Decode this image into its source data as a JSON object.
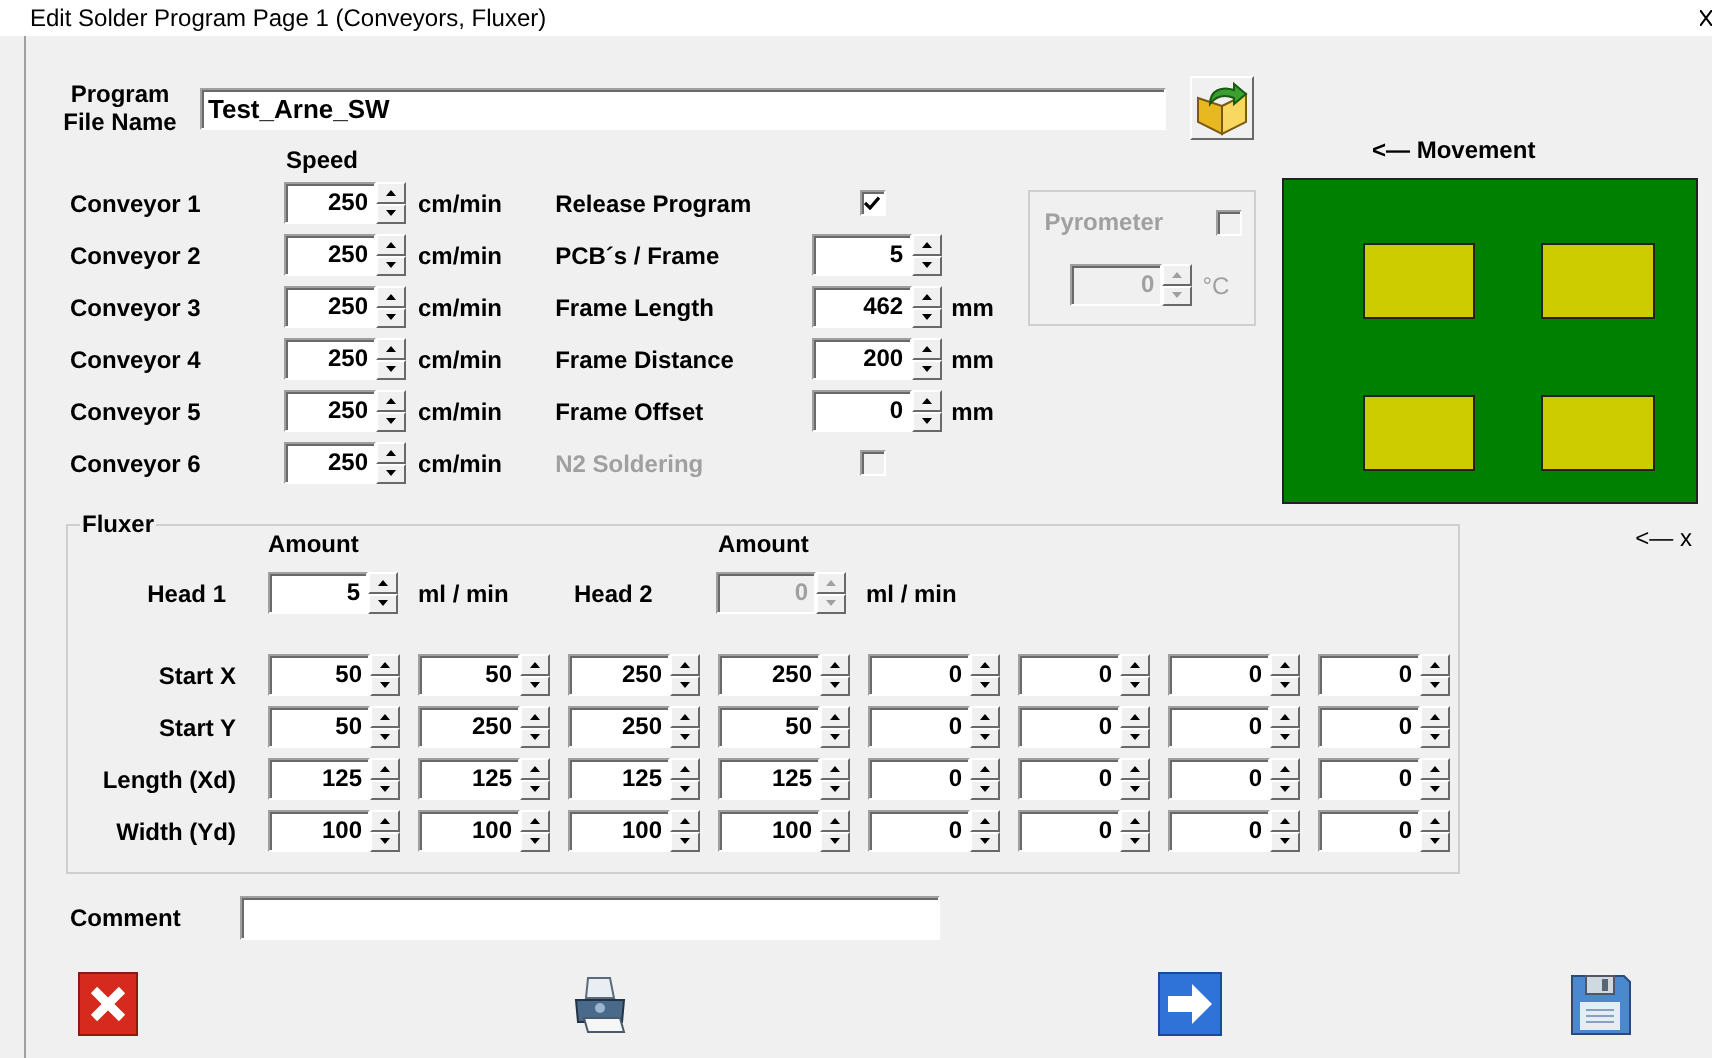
{
  "window": {
    "title": "Edit Solder Program Page 1 (Conveyors, Fluxer)"
  },
  "program_file": {
    "label": "Program File Name",
    "value": "Test_Arne_SW"
  },
  "speed_header": "Speed",
  "conveyors": [
    {
      "label": "Conveyor 1",
      "value": "250",
      "unit": "cm/min"
    },
    {
      "label": "Conveyor 2",
      "value": "250",
      "unit": "cm/min"
    },
    {
      "label": "Conveyor 3",
      "value": "250",
      "unit": "cm/min"
    },
    {
      "label": "Conveyor 4",
      "value": "250",
      "unit": "cm/min"
    },
    {
      "label": "Conveyor 5",
      "value": "250",
      "unit": "cm/min"
    },
    {
      "label": "Conveyor 6",
      "value": "250",
      "unit": "cm/min"
    }
  ],
  "settings": [
    {
      "kind": "checkbox",
      "label": "Release Program",
      "checked": true,
      "disabled": false
    },
    {
      "kind": "spin",
      "label": "PCB´s / Frame",
      "value": "5"
    },
    {
      "kind": "spin",
      "label": "Frame Length",
      "value": "462",
      "unit": "mm"
    },
    {
      "kind": "spin",
      "label": "Frame Distance",
      "value": "200",
      "unit": "mm"
    },
    {
      "kind": "spin",
      "label": "Frame Offset",
      "value": "0",
      "unit": "mm"
    },
    {
      "kind": "checkbox",
      "label": "N2 Soldering",
      "checked": false,
      "disabled": true
    }
  ],
  "pyrometer": {
    "label": "Pyrometer",
    "checked": false,
    "disabled": true,
    "value": "0",
    "unit": "°C"
  },
  "movement_label": "<— Movement",
  "x_axis_label": "<— x",
  "fluxer": {
    "title": "Fluxer",
    "heads": [
      {
        "amount_header": "Amount",
        "label": "Head 1",
        "value": "5",
        "unit": "ml / min",
        "disabled": false
      },
      {
        "amount_header": "Amount",
        "label": "Head 2",
        "value": "0",
        "unit": "ml / min",
        "disabled": true
      }
    ],
    "rows": [
      {
        "label": "Start X",
        "values": [
          "50",
          "50",
          "250",
          "250",
          "0",
          "0",
          "0",
          "0"
        ]
      },
      {
        "label": "Start Y",
        "values": [
          "50",
          "250",
          "250",
          "50",
          "0",
          "0",
          "0",
          "0"
        ]
      },
      {
        "label": "Length (Xd)",
        "values": [
          "125",
          "125",
          "125",
          "125",
          "0",
          "0",
          "0",
          "0"
        ]
      },
      {
        "label": "Width (Yd)",
        "values": [
          "100",
          "100",
          "100",
          "100",
          "0",
          "0",
          "0",
          "0"
        ]
      }
    ]
  },
  "comment": {
    "label": "Comment"
  },
  "buttons": [
    {
      "kind": "cancel"
    },
    {
      "kind": "print"
    },
    {
      "kind": "next"
    },
    {
      "kind": "save"
    }
  ]
}
